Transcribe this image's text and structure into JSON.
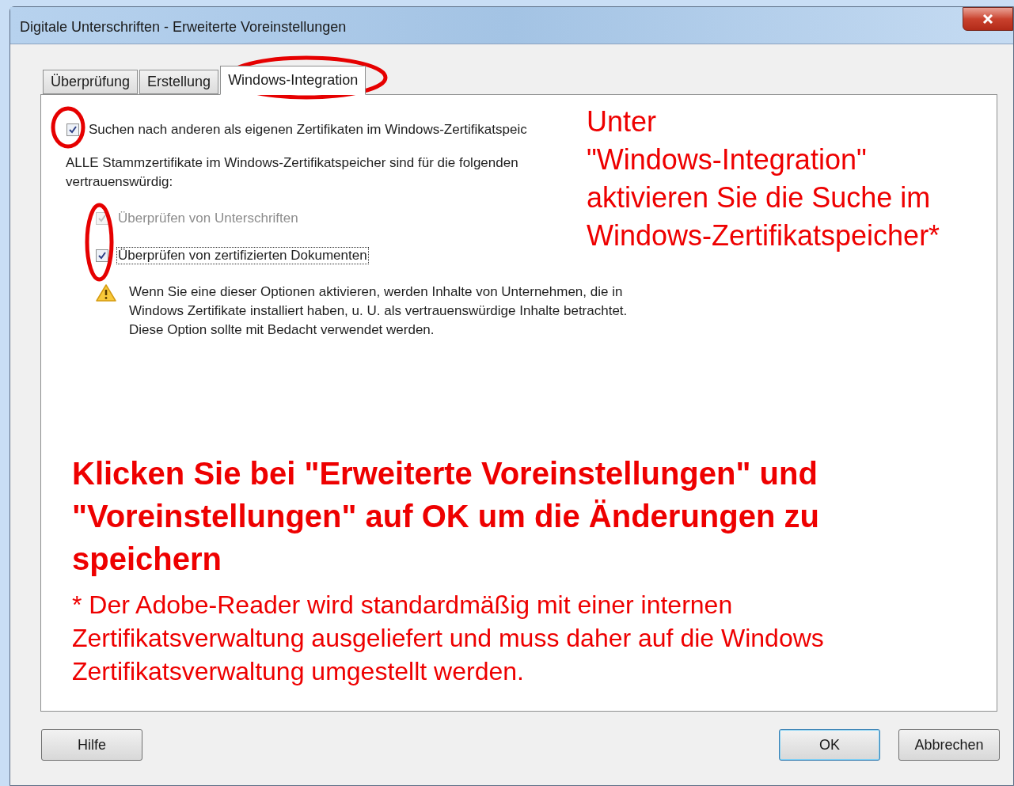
{
  "window": {
    "title": "Digitale Unterschriften - Erweiterte Voreinstellungen"
  },
  "tabs": [
    {
      "label": "Überprüfung",
      "selected": false
    },
    {
      "label": "Erstellung",
      "selected": false
    },
    {
      "label": "Windows-Integration",
      "selected": true
    }
  ],
  "search_option": {
    "label": "Suchen nach anderen als eigenen Zertifikaten im Windows-Zertifikatspeic",
    "checked": true,
    "disabled": false,
    "focused": false
  },
  "trust_text": "ALLE Stammzertifikate im Windows-Zertifikatspeicher sind für die folgenden\nvertrauenswürdig:",
  "trust_options": [
    {
      "label": "Überprüfen von Unterschriften",
      "checked": true,
      "disabled": true,
      "focused": false
    },
    {
      "label": "Überprüfen von zertifizierten Dokumenten",
      "checked": true,
      "disabled": false,
      "focused": true
    }
  ],
  "warning": "Wenn Sie eine dieser Optionen aktivieren, werden Inhalte von Unternehmen, die in\nWindows Zertifikate installiert haben, u. U. als vertrauenswürdige Inhalte betrachtet.\nDiese Option sollte mit Bedacht verwendet werden.",
  "annotations": {
    "callout": "Unter\n\"Windows-Integration\"\naktivieren Sie die Suche im\nWindows-Zertifikatspeicher*",
    "instruction": "Klicken Sie bei \"Erweiterte Voreinstellungen\" und\n\"Voreinstellungen\" auf OK um die Änderungen zu\nspeichern",
    "footnote": "* Der Adobe-Reader wird standardmäßig mit einer internen\nZertifikatsverwaltung ausgeliefert und muss daher auf die Windows\nZertifikatsverwaltung umgestellt werden."
  },
  "buttons": [
    {
      "label": "Hilfe",
      "default": false
    },
    {
      "label": "OK",
      "default": true
    },
    {
      "label": "Abbrechen",
      "default": false
    }
  ]
}
